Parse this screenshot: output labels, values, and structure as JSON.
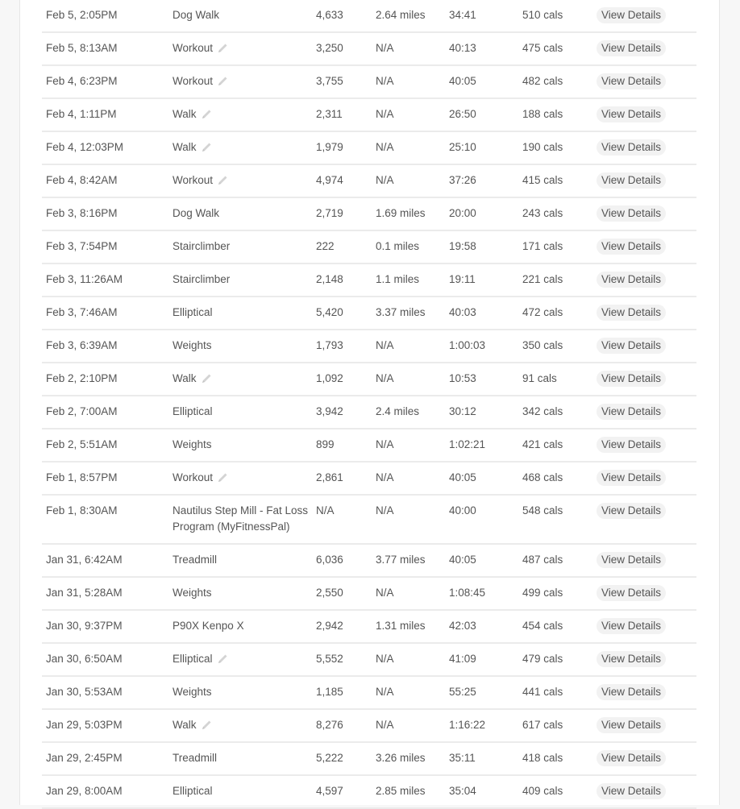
{
  "activities": {
    "view_label": "View Details",
    "rows": [
      {
        "date": "Feb 5, 2:05PM",
        "type": "Dog Walk",
        "editable": false,
        "steps": "4,633",
        "distance": "2.64 miles",
        "duration": "34:41",
        "calories": "510 cals"
      },
      {
        "date": "Feb 5, 8:13AM",
        "type": "Workout",
        "editable": true,
        "steps": "3,250",
        "distance": "N/A",
        "duration": "40:13",
        "calories": "475 cals"
      },
      {
        "date": "Feb 4, 6:23PM",
        "type": "Workout",
        "editable": true,
        "steps": "3,755",
        "distance": "N/A",
        "duration": "40:05",
        "calories": "482 cals"
      },
      {
        "date": "Feb 4, 1:11PM",
        "type": "Walk",
        "editable": true,
        "steps": "2,311",
        "distance": "N/A",
        "duration": "26:50",
        "calories": "188 cals"
      },
      {
        "date": "Feb 4, 12:03PM",
        "type": "Walk",
        "editable": true,
        "steps": "1,979",
        "distance": "N/A",
        "duration": "25:10",
        "calories": "190 cals"
      },
      {
        "date": "Feb 4, 8:42AM",
        "type": "Workout",
        "editable": true,
        "steps": "4,974",
        "distance": "N/A",
        "duration": "37:26",
        "calories": "415 cals"
      },
      {
        "date": "Feb 3, 8:16PM",
        "type": "Dog Walk",
        "editable": false,
        "steps": "2,719",
        "distance": "1.69 miles",
        "duration": "20:00",
        "calories": "243 cals"
      },
      {
        "date": "Feb 3, 7:54PM",
        "type": "Stairclimber",
        "editable": false,
        "steps": "222",
        "distance": "0.1 miles",
        "duration": "19:58",
        "calories": "171 cals"
      },
      {
        "date": "Feb 3, 11:26AM",
        "type": "Stairclimber",
        "editable": false,
        "steps": "2,148",
        "distance": "1.1 miles",
        "duration": "19:11",
        "calories": "221 cals"
      },
      {
        "date": "Feb 3, 7:46AM",
        "type": "Elliptical",
        "editable": false,
        "steps": "5,420",
        "distance": "3.37 miles",
        "duration": "40:03",
        "calories": "472 cals"
      },
      {
        "date": "Feb 3, 6:39AM",
        "type": "Weights",
        "editable": false,
        "steps": "1,793",
        "distance": "N/A",
        "duration": "1:00:03",
        "calories": "350 cals"
      },
      {
        "date": "Feb 2, 2:10PM",
        "type": "Walk",
        "editable": true,
        "steps": "1,092",
        "distance": "N/A",
        "duration": "10:53",
        "calories": "91 cals"
      },
      {
        "date": "Feb 2, 7:00AM",
        "type": "Elliptical",
        "editable": false,
        "steps": "3,942",
        "distance": "2.4 miles",
        "duration": "30:12",
        "calories": "342 cals"
      },
      {
        "date": "Feb 2, 5:51AM",
        "type": "Weights",
        "editable": false,
        "steps": "899",
        "distance": "N/A",
        "duration": "1:02:21",
        "calories": "421 cals"
      },
      {
        "date": "Feb 1, 8:57PM",
        "type": "Workout",
        "editable": true,
        "steps": "2,861",
        "distance": "N/A",
        "duration": "40:05",
        "calories": "468 cals"
      },
      {
        "date": "Feb 1, 8:30AM",
        "type": "Nautilus Step Mill - Fat Loss Program (MyFitnessPal)",
        "editable": false,
        "steps": "N/A",
        "distance": "N/A",
        "duration": "40:00",
        "calories": "548 cals"
      },
      {
        "date": "Jan 31, 6:42AM",
        "type": "Treadmill",
        "editable": false,
        "steps": "6,036",
        "distance": "3.77 miles",
        "duration": "40:05",
        "calories": "487 cals"
      },
      {
        "date": "Jan 31, 5:28AM",
        "type": "Weights",
        "editable": false,
        "steps": "2,550",
        "distance": "N/A",
        "duration": "1:08:45",
        "calories": "499 cals"
      },
      {
        "date": "Jan 30, 9:37PM",
        "type": "P90X Kenpo X",
        "editable": false,
        "steps": "2,942",
        "distance": "1.31 miles",
        "duration": "42:03",
        "calories": "454 cals"
      },
      {
        "date": "Jan 30, 6:50AM",
        "type": "Elliptical",
        "editable": true,
        "steps": "5,552",
        "distance": "N/A",
        "duration": "41:09",
        "calories": "479 cals"
      },
      {
        "date": "Jan 30, 5:53AM",
        "type": "Weights",
        "editable": false,
        "steps": "1,185",
        "distance": "N/A",
        "duration": "55:25",
        "calories": "441 cals"
      },
      {
        "date": "Jan 29, 5:03PM",
        "type": "Walk",
        "editable": true,
        "steps": "8,276",
        "distance": "N/A",
        "duration": "1:16:22",
        "calories": "617 cals"
      },
      {
        "date": "Jan 29, 2:45PM",
        "type": "Treadmill",
        "editable": false,
        "steps": "5,222",
        "distance": "3.26 miles",
        "duration": "35:11",
        "calories": "418 cals"
      },
      {
        "date": "Jan 29, 8:00AM",
        "type": "Elliptical",
        "editable": false,
        "steps": "4,597",
        "distance": "2.85 miles",
        "duration": "35:04",
        "calories": "409 cals"
      }
    ]
  }
}
